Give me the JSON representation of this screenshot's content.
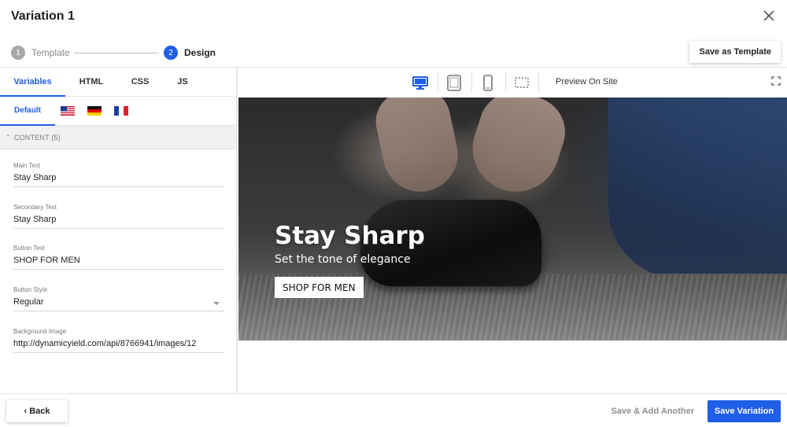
{
  "header": {
    "title": "Variation 1",
    "close_icon": "close-icon"
  },
  "stepper": {
    "steps": [
      {
        "number": "1",
        "label": "Template"
      },
      {
        "number": "2",
        "label": "Design"
      }
    ],
    "save_template_label": "Save as Template"
  },
  "left_panel": {
    "tabs": [
      {
        "label": "Variables",
        "active": true
      },
      {
        "label": "HTML"
      },
      {
        "label": "CSS"
      },
      {
        "label": "JS"
      }
    ],
    "languages": {
      "default_label": "Default",
      "flags": [
        "us-flag-icon",
        "germany-flag-icon",
        "france-flag-icon"
      ]
    },
    "section_label": "CONTENT (5)",
    "fields": [
      {
        "label": "Main Text",
        "value": "Stay Sharp"
      },
      {
        "label": "Secondary Text",
        "value": "Stay Sharp"
      },
      {
        "label": "Button Text",
        "value": "SHOP FOR MEN"
      },
      {
        "label": "Button Style",
        "value": "Regular"
      },
      {
        "label": "Background Image",
        "value": "http://dynamicyield.com/api/8766941/images/12"
      }
    ]
  },
  "toolbar": {
    "preview_label": "Preview On Site",
    "device_icons": [
      "desktop-icon",
      "tablet-icon",
      "mobile-icon",
      "custom-size-icon"
    ],
    "accent_color": "#1f5ee6"
  },
  "banner": {
    "main_text": "Stay Sharp",
    "sub_text": "Set the tone of elegance",
    "button_text": "SHOP FOR MEN"
  },
  "footer": {
    "back_label": "Back",
    "save_add_label": "Save & Add Another",
    "save_variation_label": "Save Variation"
  }
}
